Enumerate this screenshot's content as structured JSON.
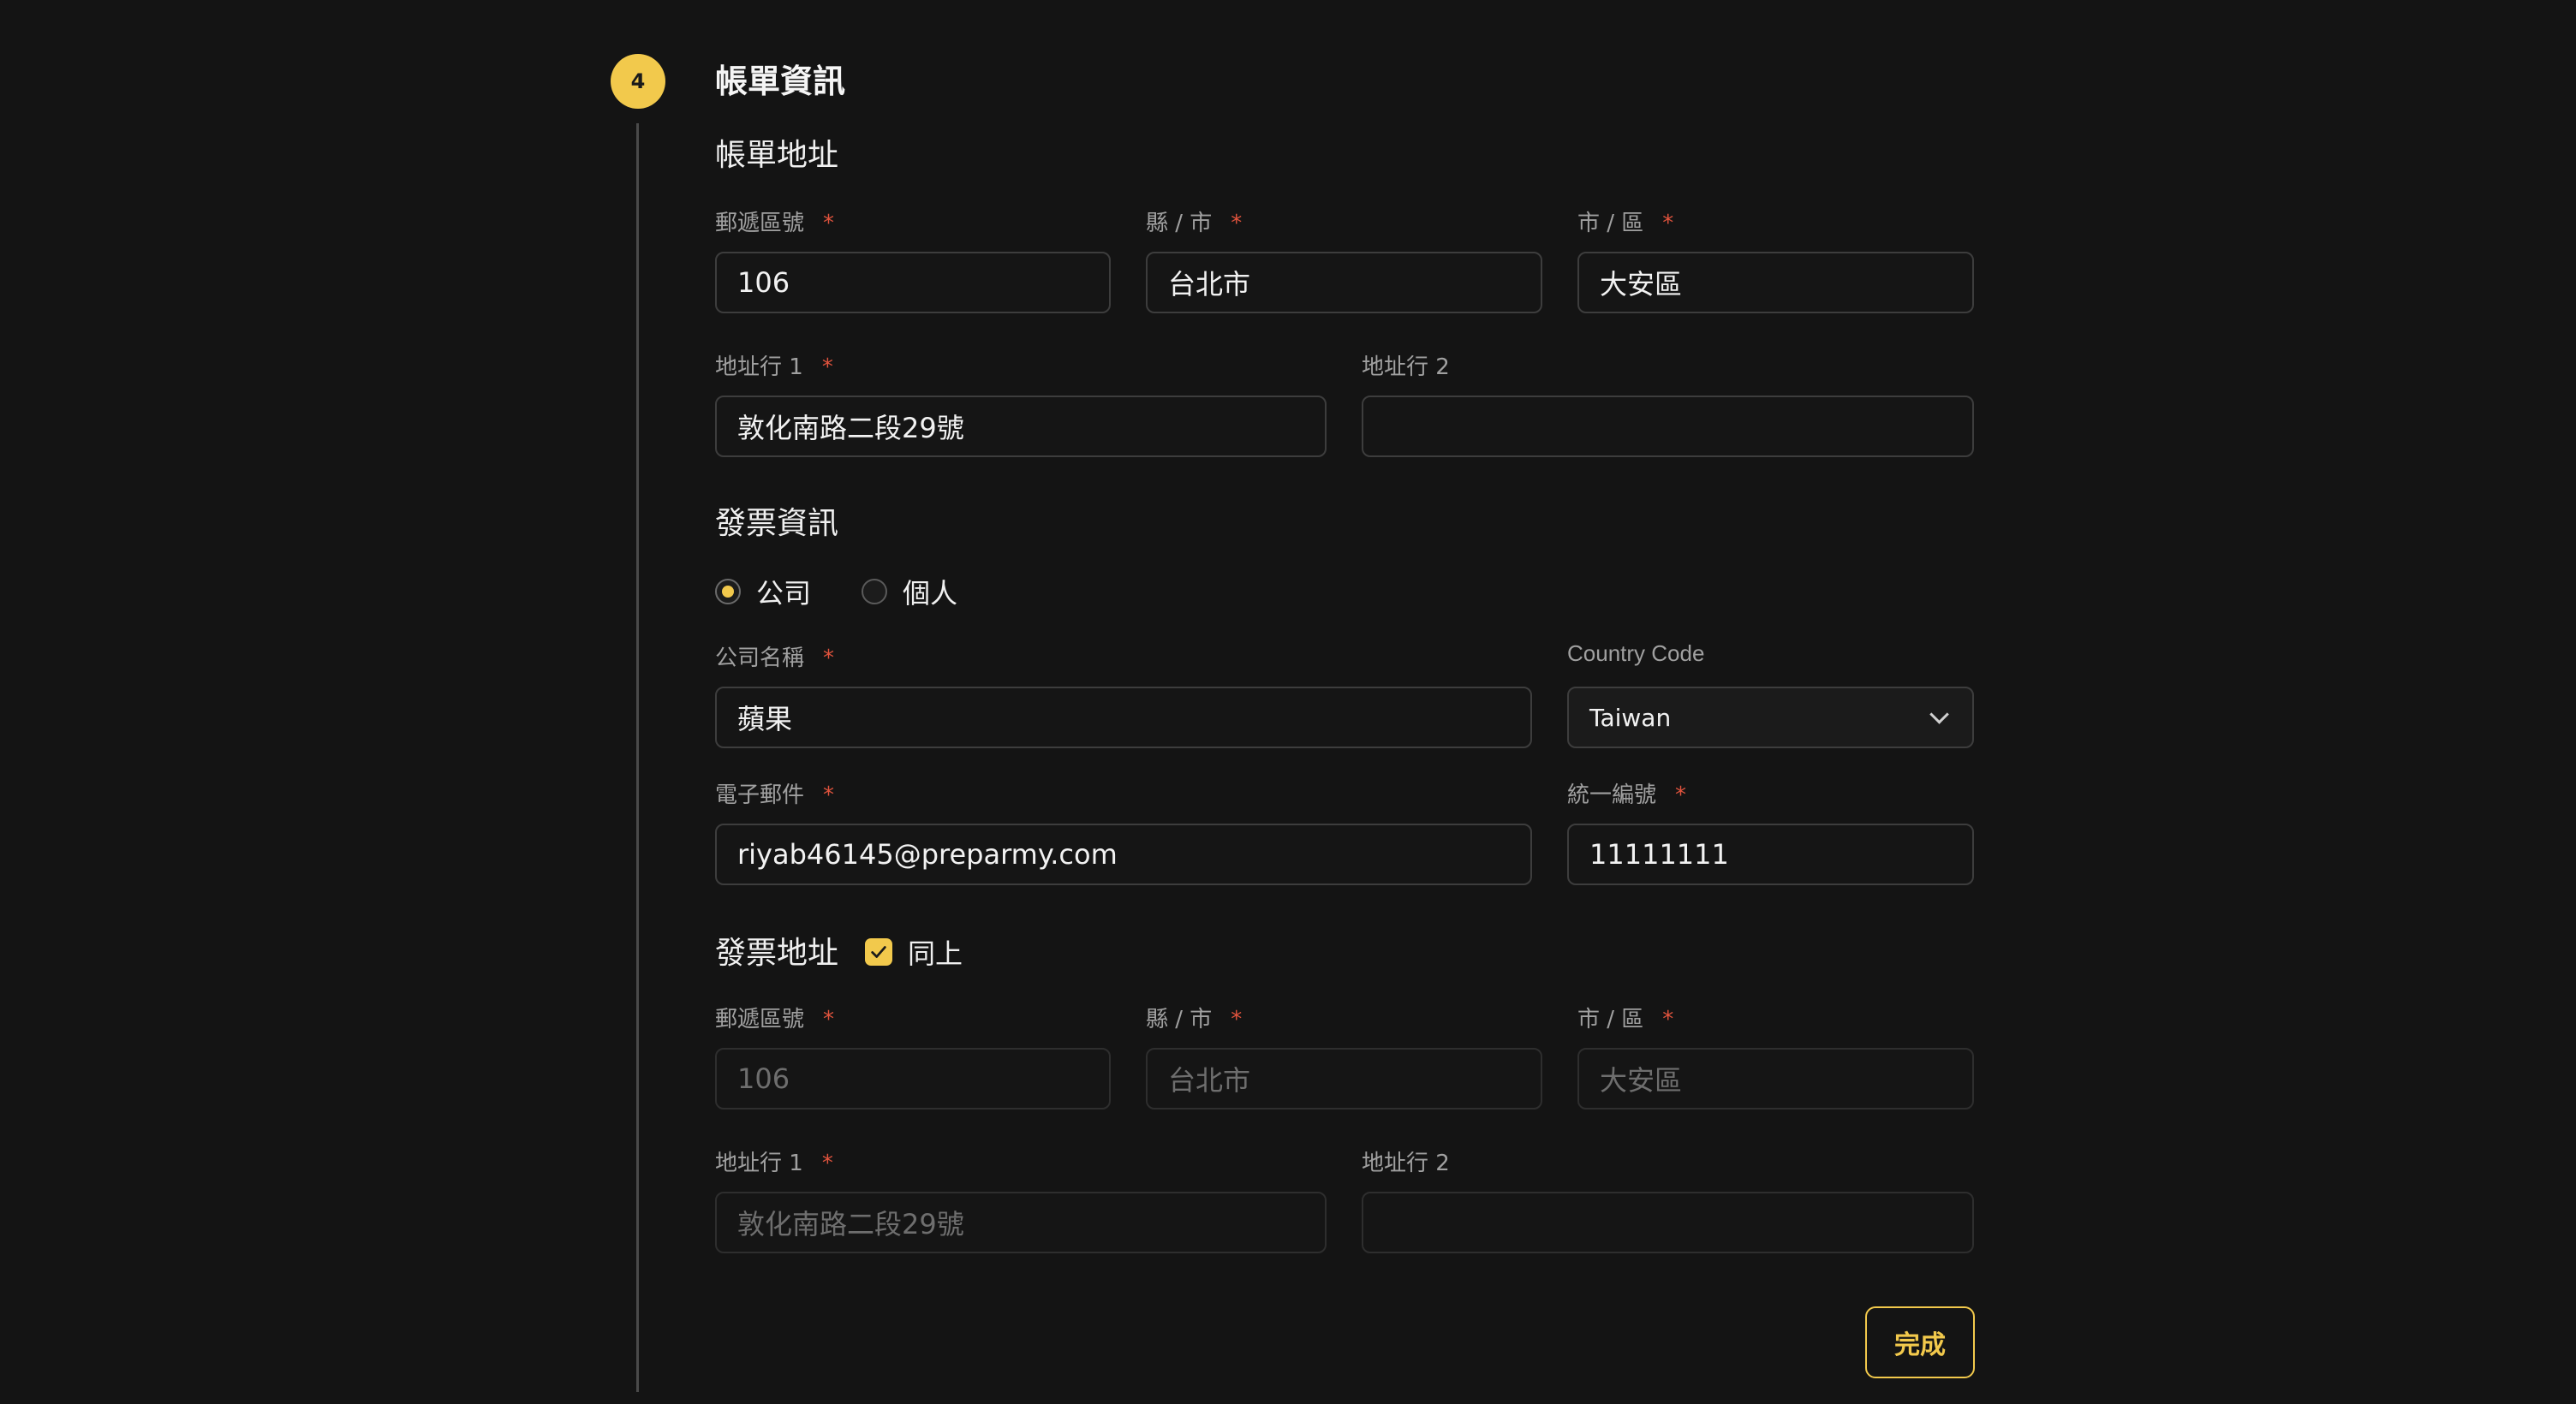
{
  "step": {
    "number": "4",
    "title": "帳單資訊"
  },
  "billing_address": {
    "title": "帳單地址",
    "postal_label": "郵遞區號",
    "county_label": "縣 / 市",
    "district_label": "市 / 區",
    "addr1_label": "地址行 1",
    "addr2_label": "地址行 2",
    "postal_value": "106",
    "county_value": "台北市",
    "district_value": "大安區",
    "addr1_value": "敦化南路二段29號",
    "addr2_value": "",
    "required_mark": "*"
  },
  "invoice": {
    "title": "發票資訊",
    "type_options": [
      {
        "label": "公司",
        "selected": true
      },
      {
        "label": "個人",
        "selected": false
      }
    ],
    "company_label": "公司名稱",
    "company_value": "蘋果",
    "country_label": "Country Code",
    "country_value": "Taiwan",
    "email_label": "電子郵件",
    "email_value": "riyab46145@preparmy.com",
    "taxid_label": "統一編號",
    "taxid_value": "11111111"
  },
  "invoice_address": {
    "title": "發票地址",
    "same_as_above_label": "同上",
    "same_as_above_checked": true,
    "postal_label": "郵遞區號",
    "county_label": "縣 / 市",
    "district_label": "市 / 區",
    "addr1_label": "地址行 1",
    "addr2_label": "地址行 2",
    "postal_value": "106",
    "county_value": "台北市",
    "district_value": "大安區",
    "addr1_value": "敦化南路二段29號",
    "addr2_value": ""
  },
  "actions": {
    "done_label": "完成"
  },
  "colors": {
    "accent": "#f2c94c",
    "required": "#e0533d",
    "background": "#141414"
  }
}
